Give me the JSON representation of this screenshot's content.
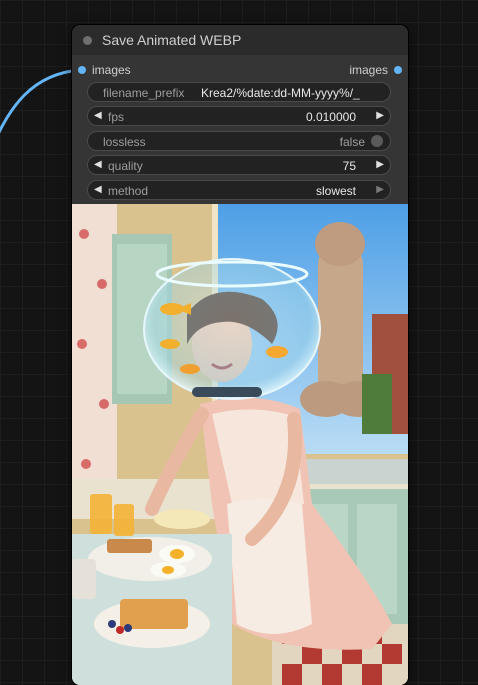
{
  "node": {
    "title": "Save Animated WEBP",
    "input_slot": "images",
    "output_slot": "images",
    "slot_color": "#64b5f6"
  },
  "widgets": {
    "filename_prefix": {
      "label": "filename_prefix",
      "value": "Krea2/%date:dd-MM-yyyy%/_"
    },
    "fps": {
      "label": "fps",
      "value": "0.010000"
    },
    "lossless": {
      "label": "lossless",
      "value": "false"
    },
    "quality": {
      "label": "quality",
      "value": "75"
    },
    "method": {
      "label": "method",
      "value": "slowest"
    }
  },
  "icons": {
    "left_arrow": "◀",
    "right_arrow": "▶"
  }
}
